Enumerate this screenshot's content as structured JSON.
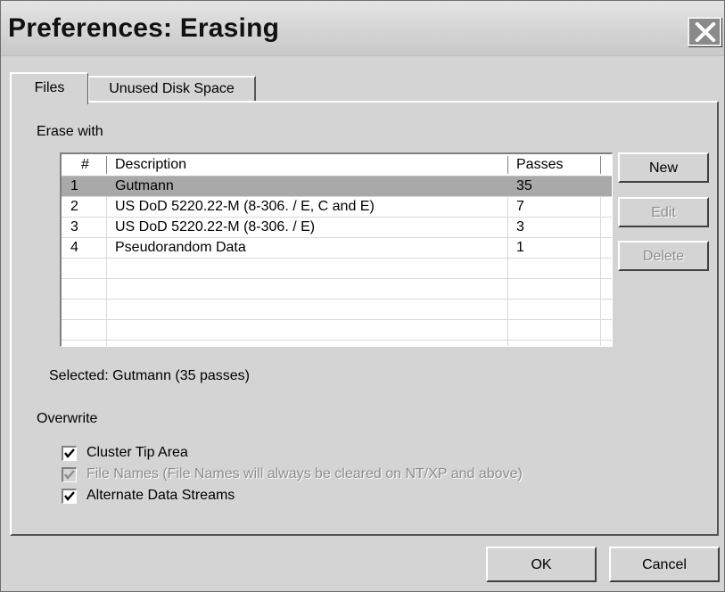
{
  "window": {
    "title": "Preferences: Erasing",
    "close_icon": "close-icon"
  },
  "tabs": [
    {
      "label": "Files",
      "active": true
    },
    {
      "label": "Unused Disk Space",
      "active": false
    }
  ],
  "erase_section": {
    "label": "Erase with",
    "columns": [
      "#",
      "Description",
      "Passes"
    ],
    "rows": [
      {
        "num": "1",
        "description": "Gutmann",
        "passes": "35",
        "selected": true
      },
      {
        "num": "2",
        "description": "US DoD 5220.22-M (8-306. / E, C and E)",
        "passes": "7",
        "selected": false
      },
      {
        "num": "3",
        "description": "US DoD 5220.22-M (8-306. / E)",
        "passes": "3",
        "selected": false
      },
      {
        "num": "4",
        "description": "Pseudorandom Data",
        "passes": "1",
        "selected": false
      }
    ],
    "selected_text": "Selected: Gutmann (35 passes)",
    "buttons": {
      "new": "New",
      "edit": "Edit",
      "delete": "Delete"
    }
  },
  "overwrite": {
    "label": "Overwrite",
    "options": [
      {
        "label": "Cluster Tip Area",
        "checked": true,
        "enabled": true
      },
      {
        "label": "File Names (File Names will always be cleared on NT/XP and above)",
        "checked": true,
        "enabled": false
      },
      {
        "label": "Alternate Data Streams",
        "checked": true,
        "enabled": true
      }
    ]
  },
  "footer": {
    "ok": "OK",
    "cancel": "Cancel"
  }
}
